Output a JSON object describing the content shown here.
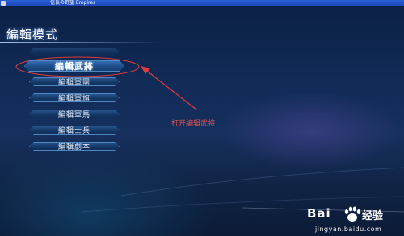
{
  "window": {
    "title": "信長の野望 Empires"
  },
  "screen": {
    "title": "編輯模式"
  },
  "menu": {
    "items": [
      {
        "label": ""
      },
      {
        "label": "編輯武將"
      },
      {
        "label": "編輯軍團"
      },
      {
        "label": "編輯軍旗"
      },
      {
        "label": "編輯軍馬"
      },
      {
        "label": "編輯士兵"
      },
      {
        "label": "編輯劇本"
      }
    ],
    "selected_index": 1
  },
  "annotation": {
    "text": "打开编辑武将",
    "color": "#e05050"
  },
  "watermark": {
    "brand": "Bai",
    "brand_suffix": "经验",
    "site": "jingyan.baidu.com"
  }
}
